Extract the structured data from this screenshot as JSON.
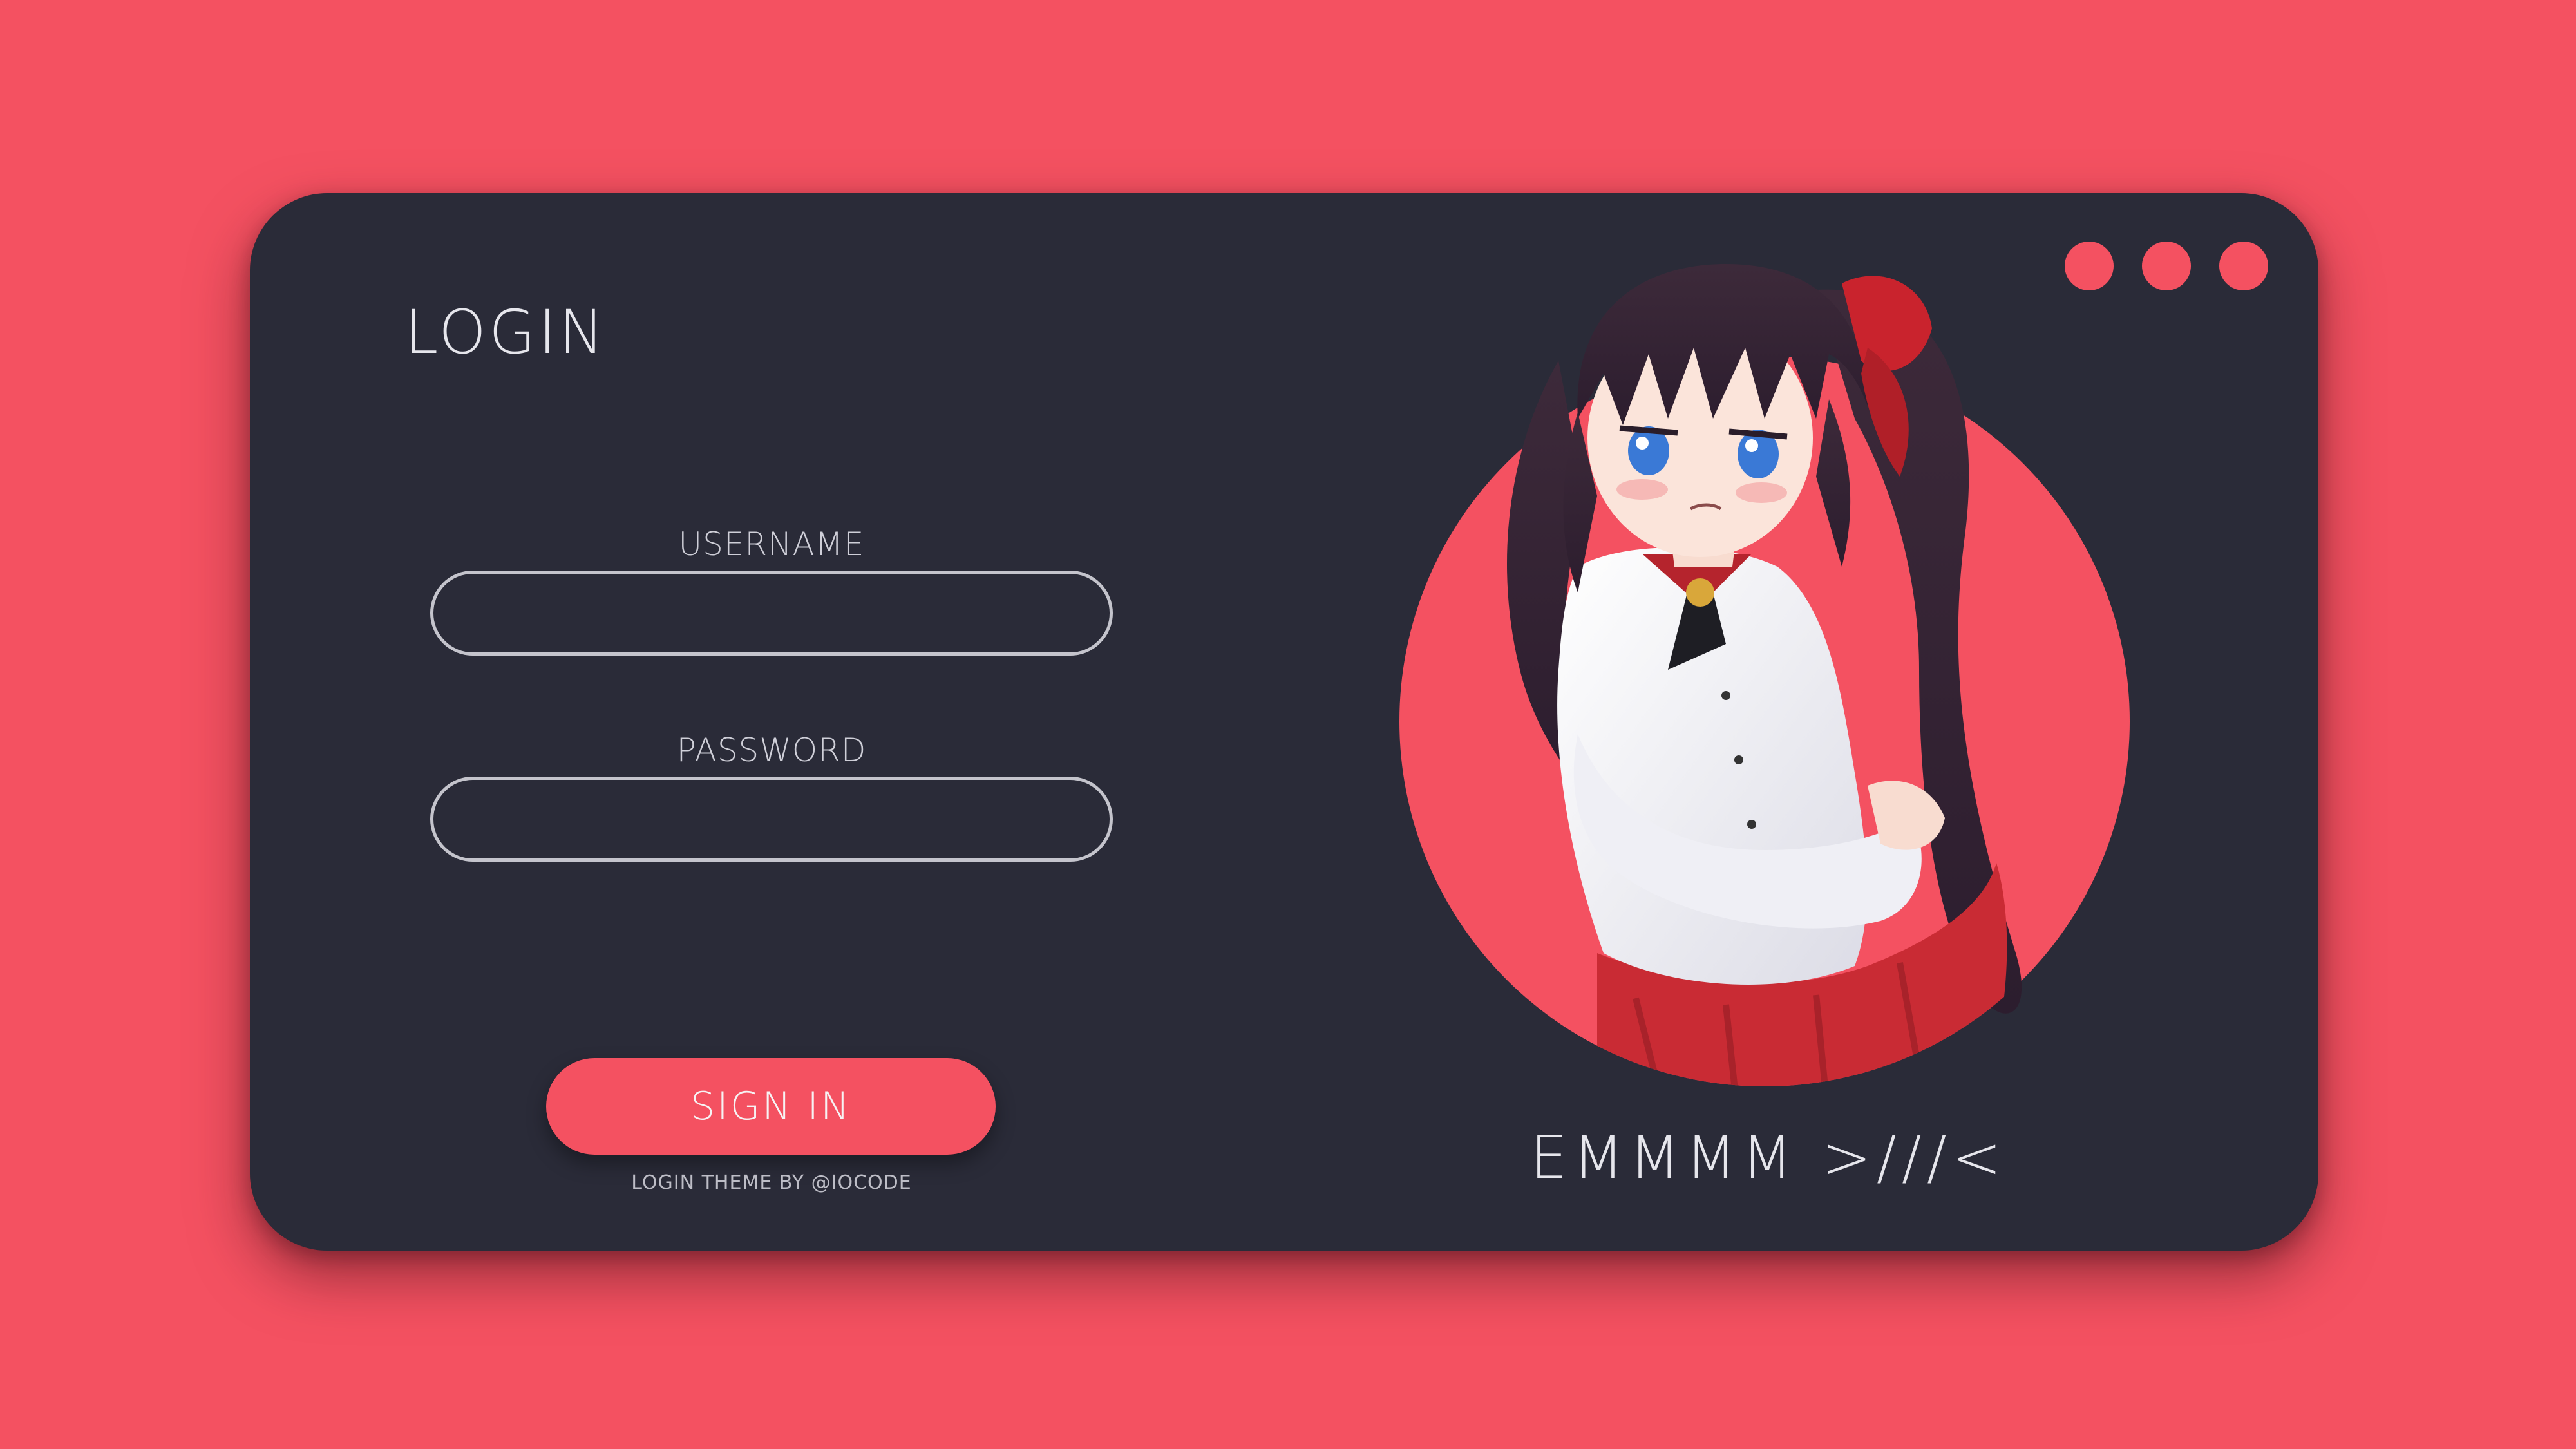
{
  "login": {
    "title": "LOGIN",
    "username_label": "USERNAME",
    "username_value": "",
    "password_label": "PASSWORD",
    "password_value": "",
    "sign_in_label": "SIGN IN",
    "credit": "LOGIN THEME BY @IOCODE"
  },
  "window_controls": [
    "dot",
    "dot",
    "dot"
  ],
  "illustration": {
    "caption": "EMMMM >///<",
    "subject": "anime-girl-portrait"
  },
  "colors": {
    "background": "#f45161",
    "card": "#2a2b38",
    "accent": "#f45161",
    "text": "#e6e6ec",
    "input_border": "#c4c4cc"
  }
}
